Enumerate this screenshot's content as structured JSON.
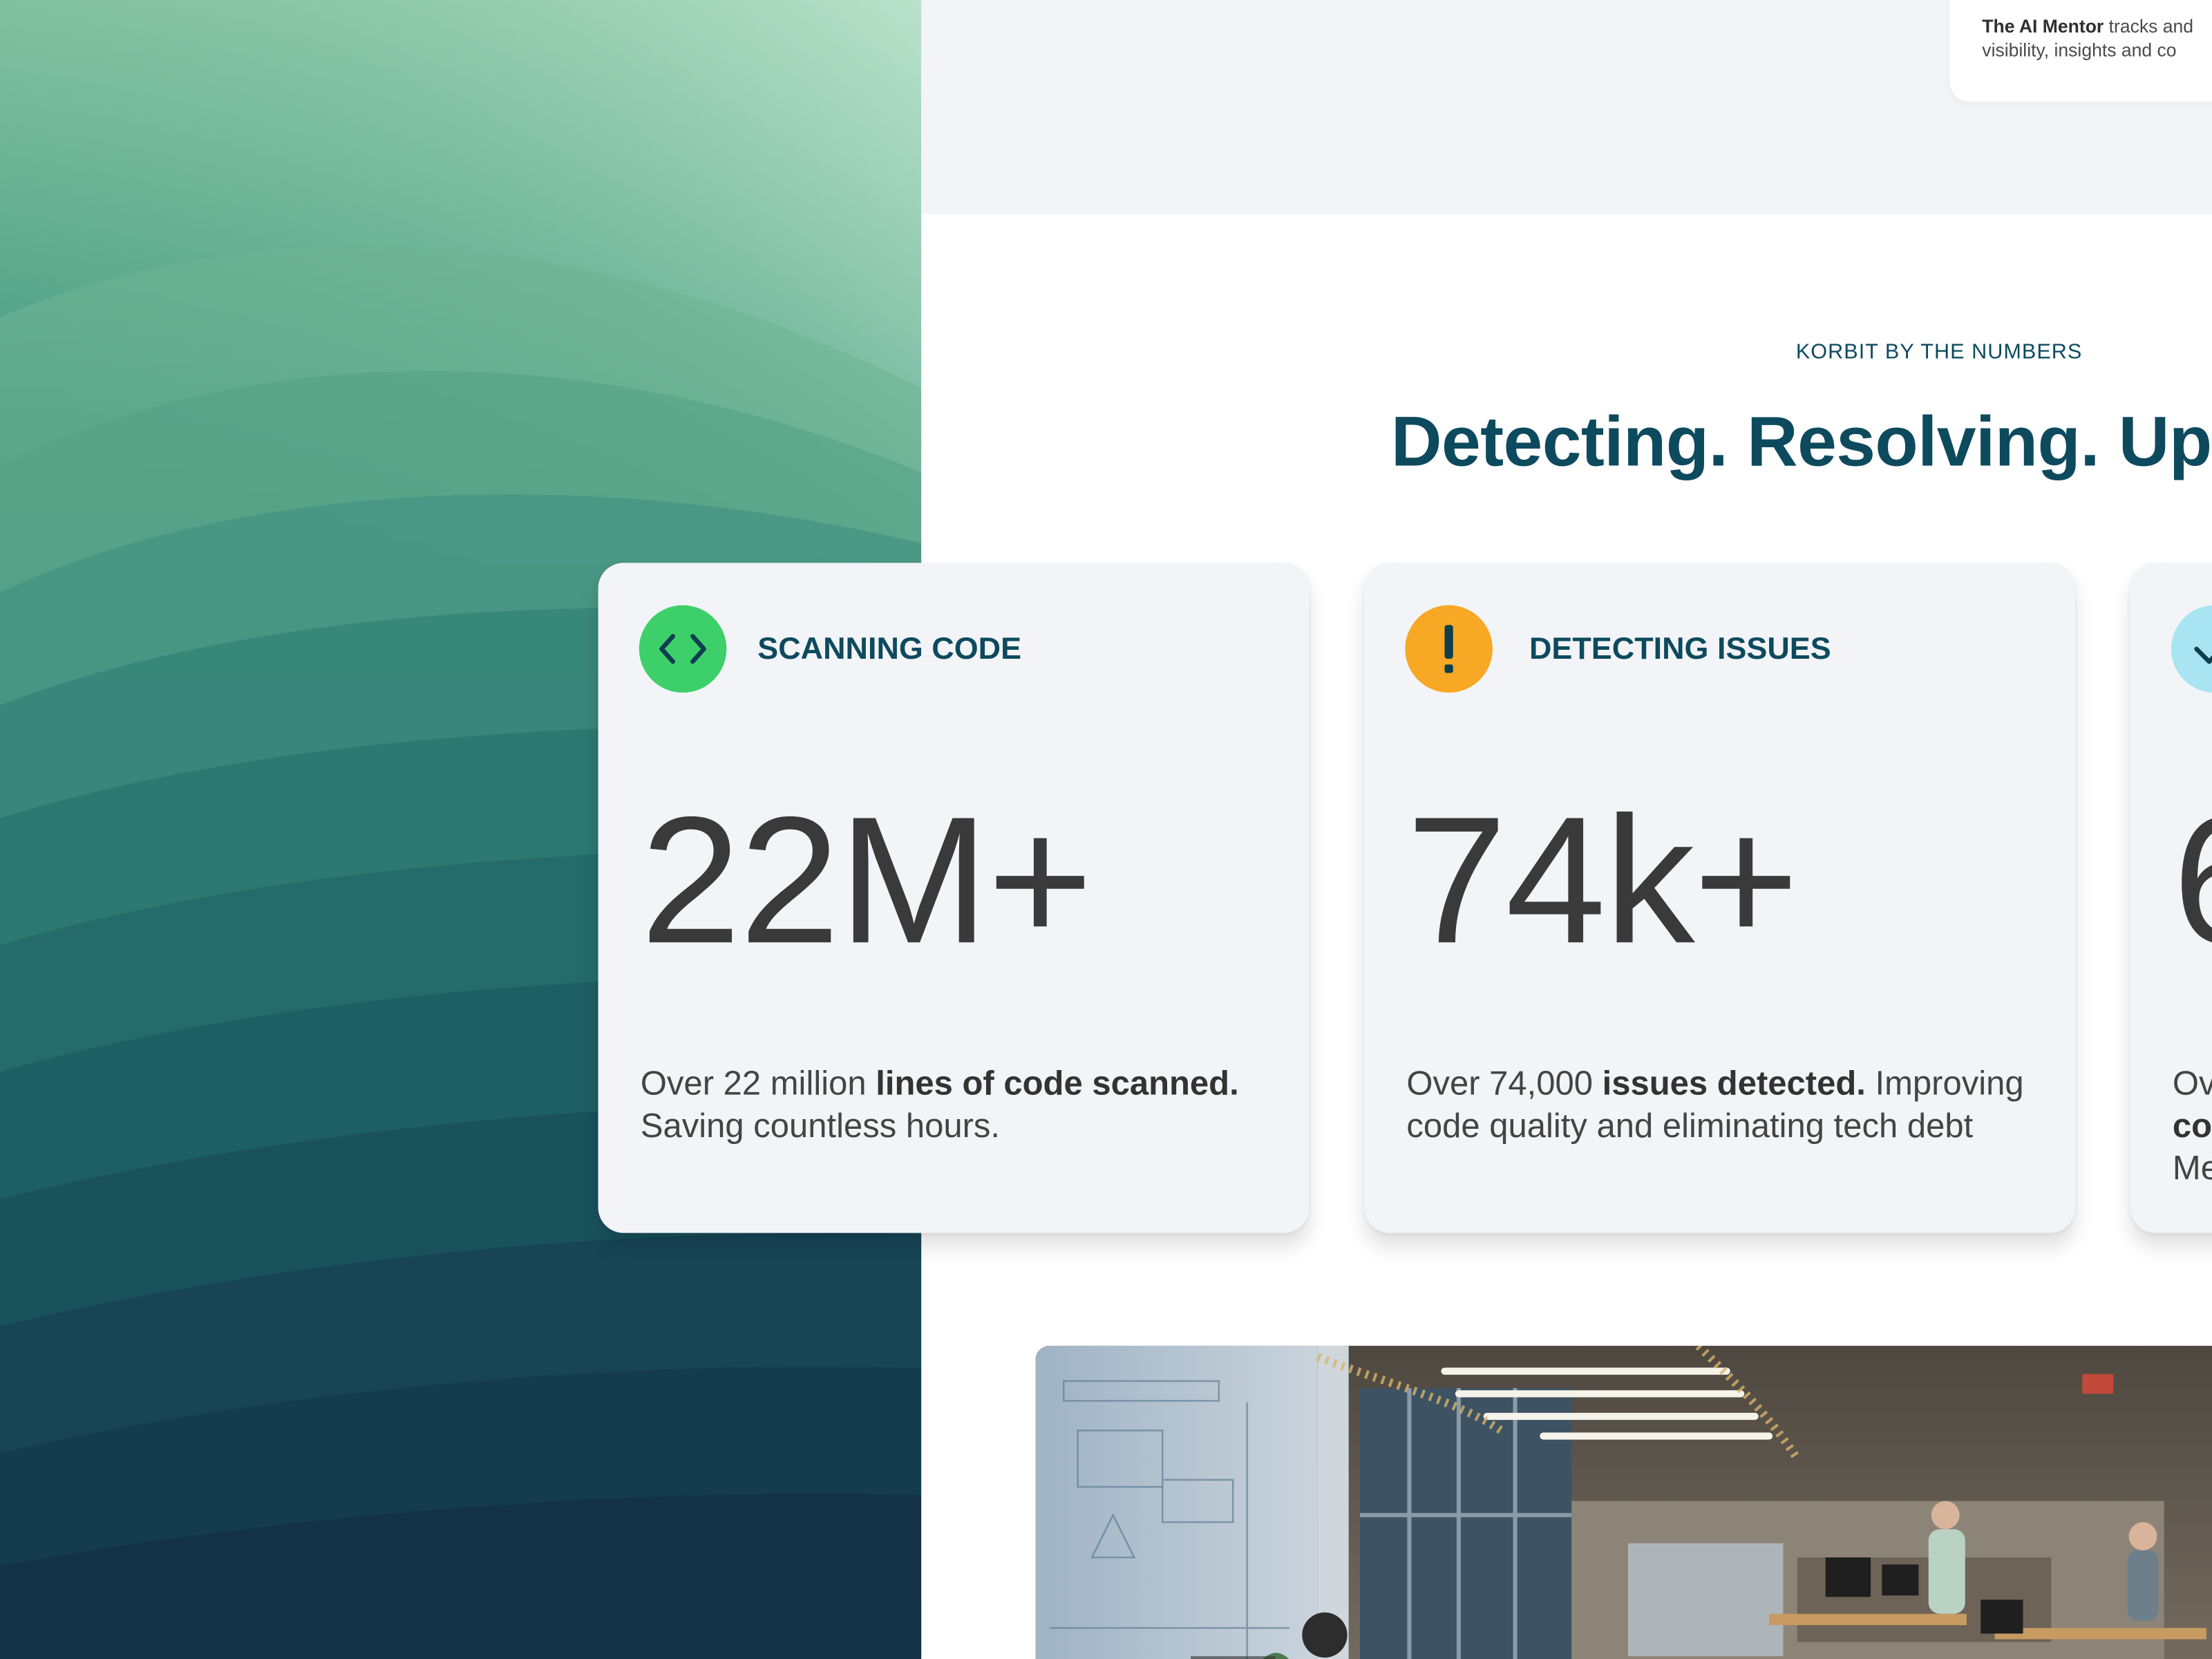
{
  "mentor": {
    "bold": "The AI Mentor",
    "line1_rest": " tracks and",
    "line2": "visibility, insights and co"
  },
  "section": {
    "eyebrow": "KORBIT BY THE NUMBERS",
    "headline": "Detecting. Resolving. Ups"
  },
  "cards": [
    {
      "icon": "code-brackets-icon",
      "icon_color": "#3dd06a",
      "title": "SCANNING CODE",
      "number": "22M+",
      "desc_pre": "Over 22 million ",
      "desc_bold": "lines of code scanned.",
      "desc_post": " Saving countless hours."
    },
    {
      "icon": "exclamation-icon",
      "icon_color": "#f7a824",
      "title": "DETECTING ISSUES",
      "number": "74k+",
      "desc_pre": "Over 74,000 ",
      "desc_bold": "issues detected.",
      "desc_post": " Improving code quality and eliminating tech debt"
    },
    {
      "icon": "check-icon",
      "icon_color": "#a8e4f2",
      "title": "",
      "number": "6",
      "desc_line1": "Ov",
      "desc_line2": "co",
      "desc_line3": "Me"
    }
  ],
  "colors": {
    "heading": "#0d4a5e",
    "body_text": "#444444",
    "card_bg": "#f3f4f7",
    "band_bg": "#f3f4f7"
  }
}
